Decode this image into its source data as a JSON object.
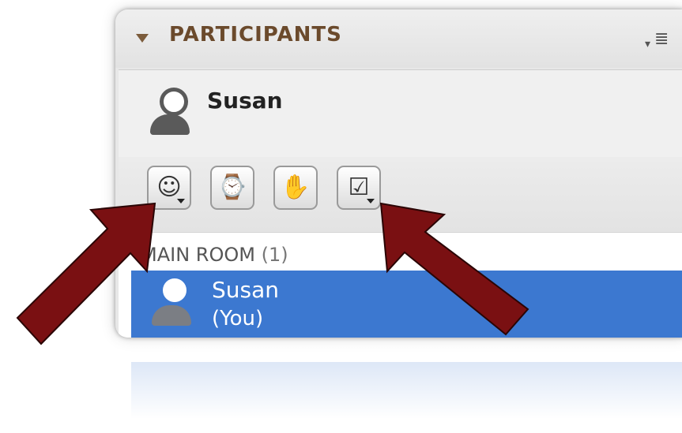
{
  "panel": {
    "title": "PARTICIPANTS"
  },
  "current_user": {
    "name": "Susan"
  },
  "toolbar": {
    "buttons": [
      {
        "icon": "smiley-status-icon"
      },
      {
        "icon": "user-away-clock-icon"
      },
      {
        "icon": "raise-hand-icon"
      },
      {
        "icon": "checkbox-poll-icon"
      }
    ]
  },
  "room": {
    "label": "MAIN ROOM",
    "count": "(1)",
    "participants": [
      {
        "name": "Susan",
        "tag": "(You)",
        "selected": true
      }
    ]
  },
  "colors": {
    "header_text": "#6b4a2c",
    "selection": "#3c78d0",
    "arrow": "#7a1012"
  }
}
